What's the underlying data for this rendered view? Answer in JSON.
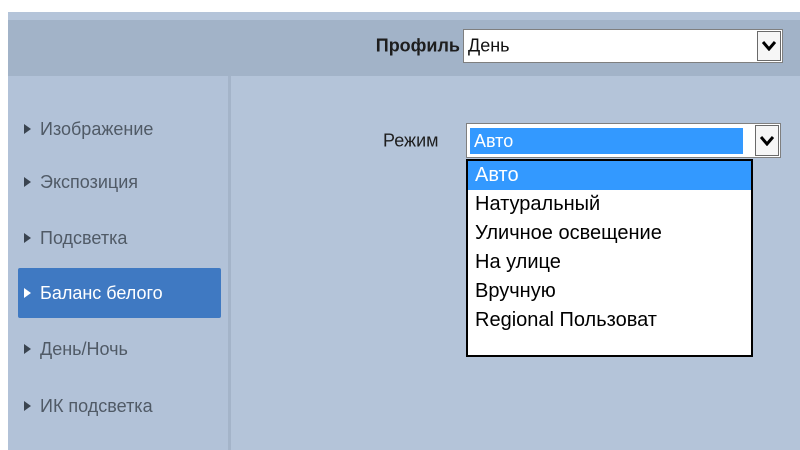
{
  "header": {
    "profile_label": "Профиль",
    "profile_value": "День"
  },
  "sidebar": {
    "items": [
      {
        "label": "Изображение",
        "active": false
      },
      {
        "label": "Экспозиция",
        "active": false
      },
      {
        "label": "Подсветка",
        "active": false
      },
      {
        "label": "Баланс белого",
        "active": true
      },
      {
        "label": "День/Ночь",
        "active": false
      },
      {
        "label": "ИК подсветка",
        "active": false
      }
    ]
  },
  "main": {
    "mode_label": "Режим",
    "mode_value": "Авто",
    "mode_options": [
      {
        "label": "Авто",
        "selected": true
      },
      {
        "label": "Натуральный",
        "selected": false
      },
      {
        "label": "Уличное освещение",
        "selected": false
      },
      {
        "label": "На улице",
        "selected": false
      },
      {
        "label": "Вручную",
        "selected": false
      },
      {
        "label": "Regional Пользоват",
        "selected": false
      }
    ]
  },
  "icons": {
    "nav_bullet": "triangle-right-icon",
    "select_arrow": "chevron-down-icon"
  },
  "colors": {
    "background": "#b4c4d9",
    "topbar": "#a2b3c8",
    "active_nav": "#3f79c2",
    "selection": "#3399ff"
  }
}
